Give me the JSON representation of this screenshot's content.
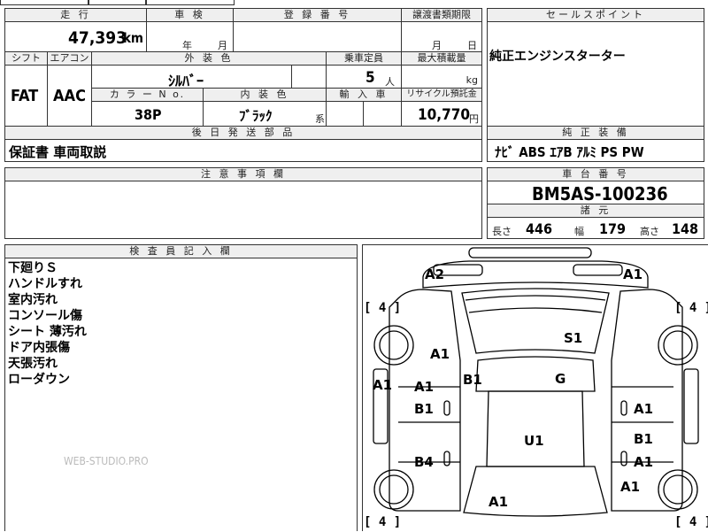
{
  "headers": {
    "mileage": "走 行",
    "inspection": "車 検",
    "registration": "登 録 番 号",
    "transfer_deadline": "譲渡書類期限",
    "sales_point": "セールスポイント",
    "shift": "シフト",
    "aircon": "エアコン",
    "exterior_color": "外 装 色",
    "capacity": "乗車定員",
    "max_load": "最大積載量",
    "color_no": "カ ラ ー N o.",
    "interior_color": "内 装 色",
    "import_car": "輸 入 車",
    "recycle_deposit": "リサイクル預託金",
    "later_parts": "後 日 発 送 部 品",
    "standard_equipment": "純 正 装 備",
    "notes": "注 意 事 項 欄",
    "chassis_no": "車 台 番 号",
    "specs": "諸 元",
    "inspector_notes": "検 査 員 記 入 欄"
  },
  "vehicle": {
    "mileage": "47,393",
    "mileage_unit": "km",
    "inspection_year_unit": "年",
    "inspection_month_unit": "月",
    "transfer_month_unit": "月",
    "transfer_day_unit": "日",
    "shift": "FAT",
    "aircon": "AAC",
    "exterior_color": "ｼﾙﾊﾞｰ",
    "capacity": "5",
    "capacity_unit": "人",
    "max_load_unit": "kg",
    "color_no": "38P",
    "interior_color": "ﾌﾞﾗｯｸ",
    "interior_suffix": "系",
    "recycle_deposit": "10,770",
    "recycle_unit": "円",
    "sales_point_text": "純正エンジンスターター",
    "later_parts_text": "保証書 車両取説",
    "standard_equipment_text": "ﾅﾋﾞ ABS ｴｱB ｱﾙﾐ PS PW",
    "chassis_no": "BM5AS-100236",
    "length_label": "長さ",
    "length": "446",
    "width_label": "幅",
    "width": "179",
    "height_label": "高さ",
    "height": "148"
  },
  "inspector_lines": [
    "下廻りＳ",
    "ハンドルすれ",
    "室内汚れ",
    "コンソール傷",
    "シート 薄汚れ",
    "ドア内張傷",
    "天張汚れ",
    "ローダウン"
  ],
  "watermark": "WEB-STUDIO.PRO",
  "diagram": {
    "tire_fl": "[ 4 ]",
    "tire_fr": "[ 4 ]",
    "tire_rl": "[ 4 ]",
    "tire_rr": "[ 4 ]",
    "marks": {
      "hood_left": "A2",
      "hood_right": "A1",
      "front_fender_l": "A1",
      "windshield": "S1",
      "side_l": "A1",
      "front_door_l": "A1",
      "front_door_l2": "B1",
      "pillar_l": "B1",
      "roof_g": "G",
      "front_door_r": "A1",
      "roof": "U1",
      "rear_door_l": "B4",
      "rear_door_r1": "B1",
      "rear_door_r2": "A1",
      "rear_fender_r": "A1",
      "trunk": "A1"
    }
  }
}
